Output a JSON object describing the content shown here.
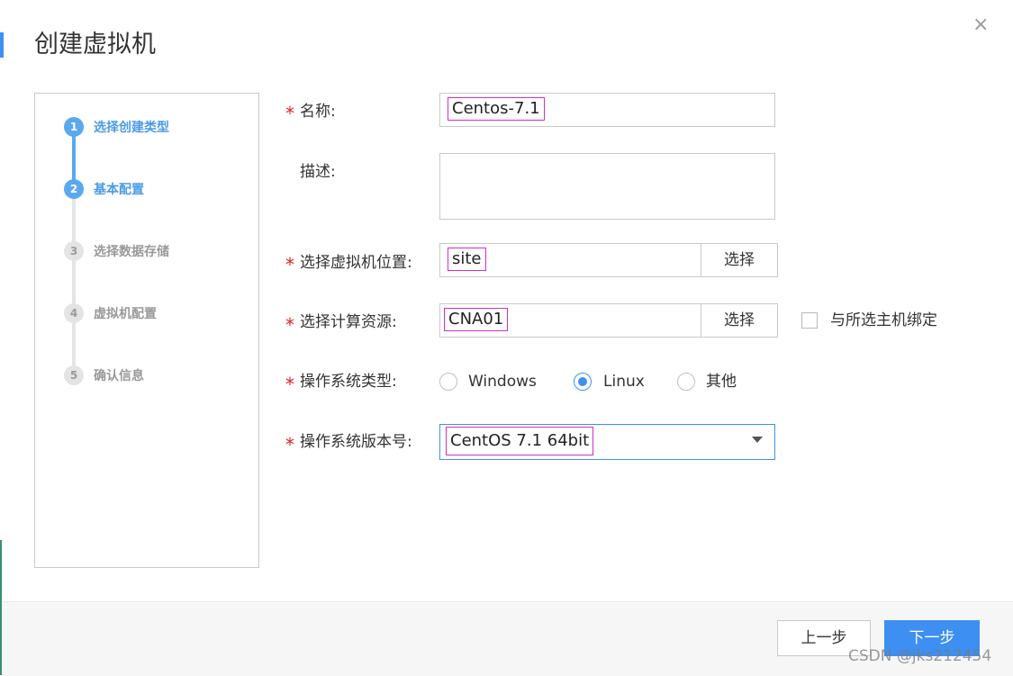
{
  "dialog": {
    "title": "创建虚拟机",
    "close_icon": "×"
  },
  "steps": [
    {
      "num": "1",
      "label": "选择创建类型",
      "state": "active"
    },
    {
      "num": "2",
      "label": "基本配置",
      "state": "active"
    },
    {
      "num": "3",
      "label": "选择数据存储",
      "state": "inactive"
    },
    {
      "num": "4",
      "label": "虚拟机配置",
      "state": "inactive"
    },
    {
      "num": "5",
      "label": "确认信息",
      "state": "inactive"
    }
  ],
  "form": {
    "required_mark": "*",
    "name": {
      "label": "名称:",
      "value": "Centos-7.1"
    },
    "description": {
      "label": "描述:",
      "value": ""
    },
    "location": {
      "label": "选择虚拟机位置:",
      "value": "site",
      "button": "选择"
    },
    "compute": {
      "label": "选择计算资源:",
      "value": "CNA01",
      "button": "选择",
      "bind_label": "与所选主机绑定",
      "bind_checked": false
    },
    "os_type": {
      "label": "操作系统类型:",
      "options": [
        "Windows",
        "Linux",
        "其他"
      ],
      "selected": "Linux"
    },
    "os_version": {
      "label": "操作系统版本号:",
      "value": "CentOS 7.1 64bit"
    }
  },
  "footer": {
    "prev": "上一步",
    "next": "下一步"
  },
  "watermark": "CSDN @jks212454",
  "colors": {
    "accent": "#3d8ff2",
    "step_active": "#5aa8f0",
    "required": "#e02020",
    "highlight_box": "#d22dcb"
  }
}
